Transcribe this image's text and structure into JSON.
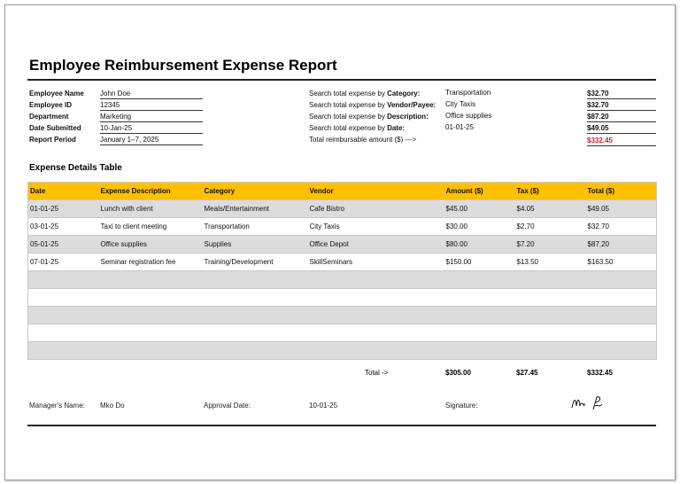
{
  "title": "Employee Reimbursement Expense Report",
  "employee_info": [
    {
      "label": "Employee Name",
      "value": "John Doe"
    },
    {
      "label": "Employee ID",
      "value": "12345"
    },
    {
      "label": "Department",
      "value": "Marketing"
    },
    {
      "label": "Date Submitted",
      "value": "10-Jan-25"
    },
    {
      "label": "Report Period",
      "value": "January 1–7, 2025"
    }
  ],
  "searches": [
    {
      "prefix": "Search total expense by ",
      "key": "Category:",
      "value": "Transportation",
      "amount": "$32.70"
    },
    {
      "prefix": "Search total expense by ",
      "key": "Vendor/Payee:",
      "value": "City Taxis",
      "amount": "$32.70"
    },
    {
      "prefix": "Search total expense by ",
      "key": "Description:",
      "value": "Office supplies",
      "amount": "$87.20"
    },
    {
      "prefix": "Search total expense by ",
      "key": "Date:",
      "value": "01-01-25",
      "amount": "$49.05"
    }
  ],
  "total_reimbursable": {
    "label": "Total reimbursable amount ($) --->",
    "amount": "$332.45",
    "color": "#d0202a"
  },
  "section_title": "Expense Details Table",
  "table": {
    "header_color": "#ffc000",
    "columns": [
      "Date",
      "Expense Description",
      "Category",
      "Vendor",
      "Amount ($)",
      "Tax ($)",
      "Total ($)"
    ],
    "rows": [
      [
        "01-01-25",
        "Lunch with client",
        "Meals/Entertainment",
        "Cafe Bistro",
        "$45.00",
        "$4.05",
        "$49.05"
      ],
      [
        "03-01-25",
        "Taxi to client meeting",
        "Transportation",
        "City Taxis",
        "$30.00",
        "$2.70",
        "$32.70"
      ],
      [
        "05-01-25",
        "Office supplies",
        "Supplies",
        "Office Depot",
        "$80.00",
        "$7.20",
        "$87.20"
      ],
      [
        "07-01-25",
        "Seminar registration fee",
        "Training/Development",
        "SkillSeminars",
        "$150.00",
        "$13.50",
        "$163.50"
      ]
    ],
    "empty_rows": 5
  },
  "totals": {
    "label": "Total ->",
    "amount": "$305.00",
    "tax": "$27.45",
    "total": "$332.45"
  },
  "footer": {
    "manager_label": "Manager's Name:",
    "manager_value": "Mko Do",
    "approval_label": "Approval Date:",
    "approval_value": "10-01-25",
    "signature_label": "Signature:",
    "signature": "Mko Do"
  }
}
